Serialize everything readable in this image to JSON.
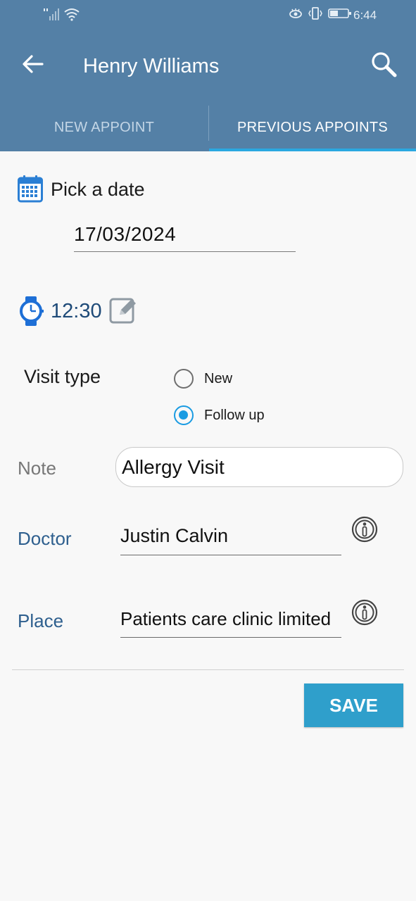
{
  "status_bar": {
    "time": "6:44",
    "icons": [
      "signal-icon",
      "wifi-icon",
      "eye-icon",
      "vibrate-icon",
      "battery-icon"
    ]
  },
  "app_bar": {
    "title": "Henry Williams",
    "back_icon": "back-arrow-icon",
    "search_icon": "search-icon"
  },
  "tabs": [
    {
      "label": "NEW APPOINT",
      "selected": false
    },
    {
      "label": "PREVIOUS APPOINTS",
      "selected": true
    }
  ],
  "form": {
    "pick_date_label": "Pick a date",
    "date_value": "17/03/2024",
    "time_value": "12:30",
    "visit_type_label": "Visit type",
    "visit_options": [
      {
        "label": "New",
        "checked": false
      },
      {
        "label": "Follow up",
        "checked": true
      }
    ],
    "note_label": "Note",
    "note_value": "Allergy Visit",
    "doctor_label": "Doctor",
    "doctor_value": "Justin Calvin",
    "place_label": "Place",
    "place_value": "Patients care clinic limited",
    "save_label": "SAVE"
  },
  "colors": {
    "header": "#5480a6",
    "tab_indicator": "#2aa8e0",
    "accent": "#1a9be2",
    "save_button": "#2f9fcb",
    "field_label_blue": "#2e5f8e"
  }
}
